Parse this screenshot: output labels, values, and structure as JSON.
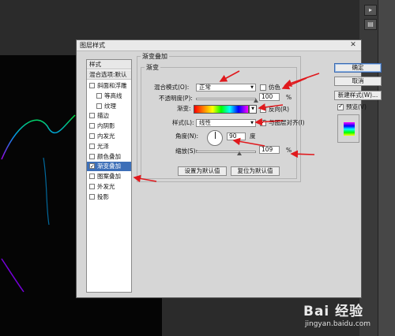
{
  "window": {
    "title": "图层样式"
  },
  "style_list": {
    "header": "样式",
    "blend_header": "混合选项:默认",
    "items": [
      {
        "label": "斜面和浮雕",
        "checked": false,
        "indent": false
      },
      {
        "label": "等高线",
        "checked": false,
        "indent": true
      },
      {
        "label": "纹理",
        "checked": false,
        "indent": true
      },
      {
        "label": "描边",
        "checked": false,
        "indent": false
      },
      {
        "label": "内阴影",
        "checked": false,
        "indent": false
      },
      {
        "label": "内发光",
        "checked": false,
        "indent": false
      },
      {
        "label": "光泽",
        "checked": false,
        "indent": false
      },
      {
        "label": "颜色叠加",
        "checked": false,
        "indent": false
      },
      {
        "label": "渐变叠加",
        "checked": true,
        "indent": false,
        "selected": true
      },
      {
        "label": "图案叠加",
        "checked": false,
        "indent": false
      },
      {
        "label": "外发光",
        "checked": false,
        "indent": false
      },
      {
        "label": "投影",
        "checked": false,
        "indent": false
      }
    ]
  },
  "gradient_overlay": {
    "group_title": "渐变叠加",
    "inner_title": "渐变",
    "blend_mode_label": "混合模式(O):",
    "blend_mode_value": "正常",
    "dither_label": "仿色",
    "dither_checked": false,
    "opacity_label": "不透明度(P):",
    "opacity_value": "100",
    "opacity_unit": "%",
    "opacity_fraction": 1.0,
    "gradient_label": "渐变:",
    "reverse_label": "反向(R)",
    "reverse_checked": false,
    "style_label": "样式(L):",
    "style_value": "线性",
    "align_label": "与图层对齐(I)",
    "align_checked": true,
    "angle_label": "角度(N):",
    "angle_value": "90",
    "angle_unit": "度",
    "scale_label": "缩放(S):",
    "scale_value": "109",
    "scale_unit": "%",
    "scale_fraction": 0.73,
    "set_default_label": "设置为默认值",
    "reset_default_label": "复位为默认值"
  },
  "buttons": {
    "ok": "确定",
    "cancel": "取消",
    "new_style": "新建样式(W)...",
    "preview_label": "预览(V)",
    "preview_checked": true
  },
  "watermark": {
    "text": "Bai 经验",
    "url": "jingyan.baidu.com"
  },
  "colors": {
    "arrow": "#e0191d",
    "selected": "#3d6fb8"
  }
}
